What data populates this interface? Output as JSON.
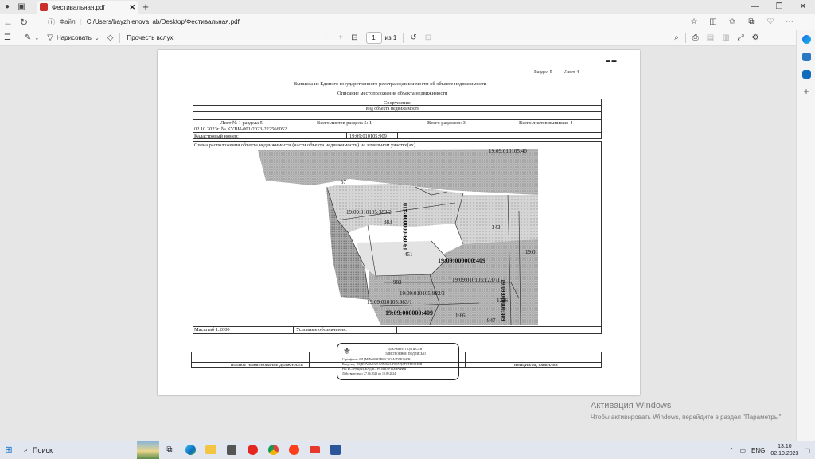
{
  "browser": {
    "tab_title": "Фестивальная.pdf",
    "address_label": "Файл",
    "address_url": "C:/Users/bayzhienova_ab/Desktop/Фестивальная.pdf"
  },
  "pdf_toolbar": {
    "draw_label": "Нарисовать",
    "read_aloud_label": "Прочесть вслух",
    "page_current": "1",
    "page_total": "из 1"
  },
  "document": {
    "section": "Раздел 5",
    "sheet": "Лист 4",
    "title": "Выписка из Единого государственного реестра недвижимости об объекте недвижимости",
    "subtitle": "Описание местоположения объекта недвижимости",
    "object_type": "Сооружение",
    "object_type_caption": "вид объекта недвижимости",
    "sheet_no": "Лист № 1 раздела 5",
    "sheets_in_section": "Всего листов раздела 5: 1",
    "sections_total": "Всего разделов: 3",
    "sheets_total": "Всего листов выписки: 4",
    "doc_number": "02.10.2023г. № КУВИ-001/2023-222566052",
    "cadastral_label": "Кадастровый номер:",
    "cadastral_number": "19:09:010105:909",
    "scheme_caption": "Схема расположения объекта недвижимости (части объекта недвижимости) на земельном участке(ах)",
    "scale": "Масштаб 1:2000",
    "legend_label": "Условные обозначения:",
    "position_caption": "полное наименование должности",
    "initials_caption": "инициалы, фамилия",
    "map_labels": [
      "19:09:010105:40",
      "19:09:010105:383/2",
      "383",
      "343",
      "451",
      "19:09:000000:409",
      "19:09:000000:410",
      "19:09:000000:409",
      "19:09:010105:1237/1",
      "983",
      "19:09:010105:982/2",
      "1236",
      "19:09:010105:983/1",
      "19:09:000000:409",
      "1:66",
      "947",
      "19:0",
      "57"
    ],
    "stamp": {
      "line1": "ДОКУМЕНТ ПОДПИСАН",
      "line2": "ЭЛЕКТРОННОЙ ПОДПИСЬЮ",
      "line3": "Сертификат: 00ЦФЕФФЕ0E9B0EC0C0A1D5B29A08",
      "line4": "Владелец: ФЕДЕРАЛЬНАЯ СЛУЖБА ГОСУДАРСТВЕННОЙ",
      "line5": "РЕГИСТРАЦИИ, КАДАСТРА И КАРТОГРАФИИ",
      "line6": "Действителен: с 27.06.2023 по 19.09.2024"
    }
  },
  "watermark": {
    "line1": "Активация Windows",
    "line2": "Чтобы активировать Windows, перейдите в раздел \"Параметры\"."
  },
  "taskbar": {
    "search_label": "Поиск",
    "lang": "ENG",
    "time": "13:10",
    "date": "02.10.2023"
  },
  "colors": {
    "pdf_icon": "#c9302c",
    "edge_accent": "#0f6cbd"
  }
}
